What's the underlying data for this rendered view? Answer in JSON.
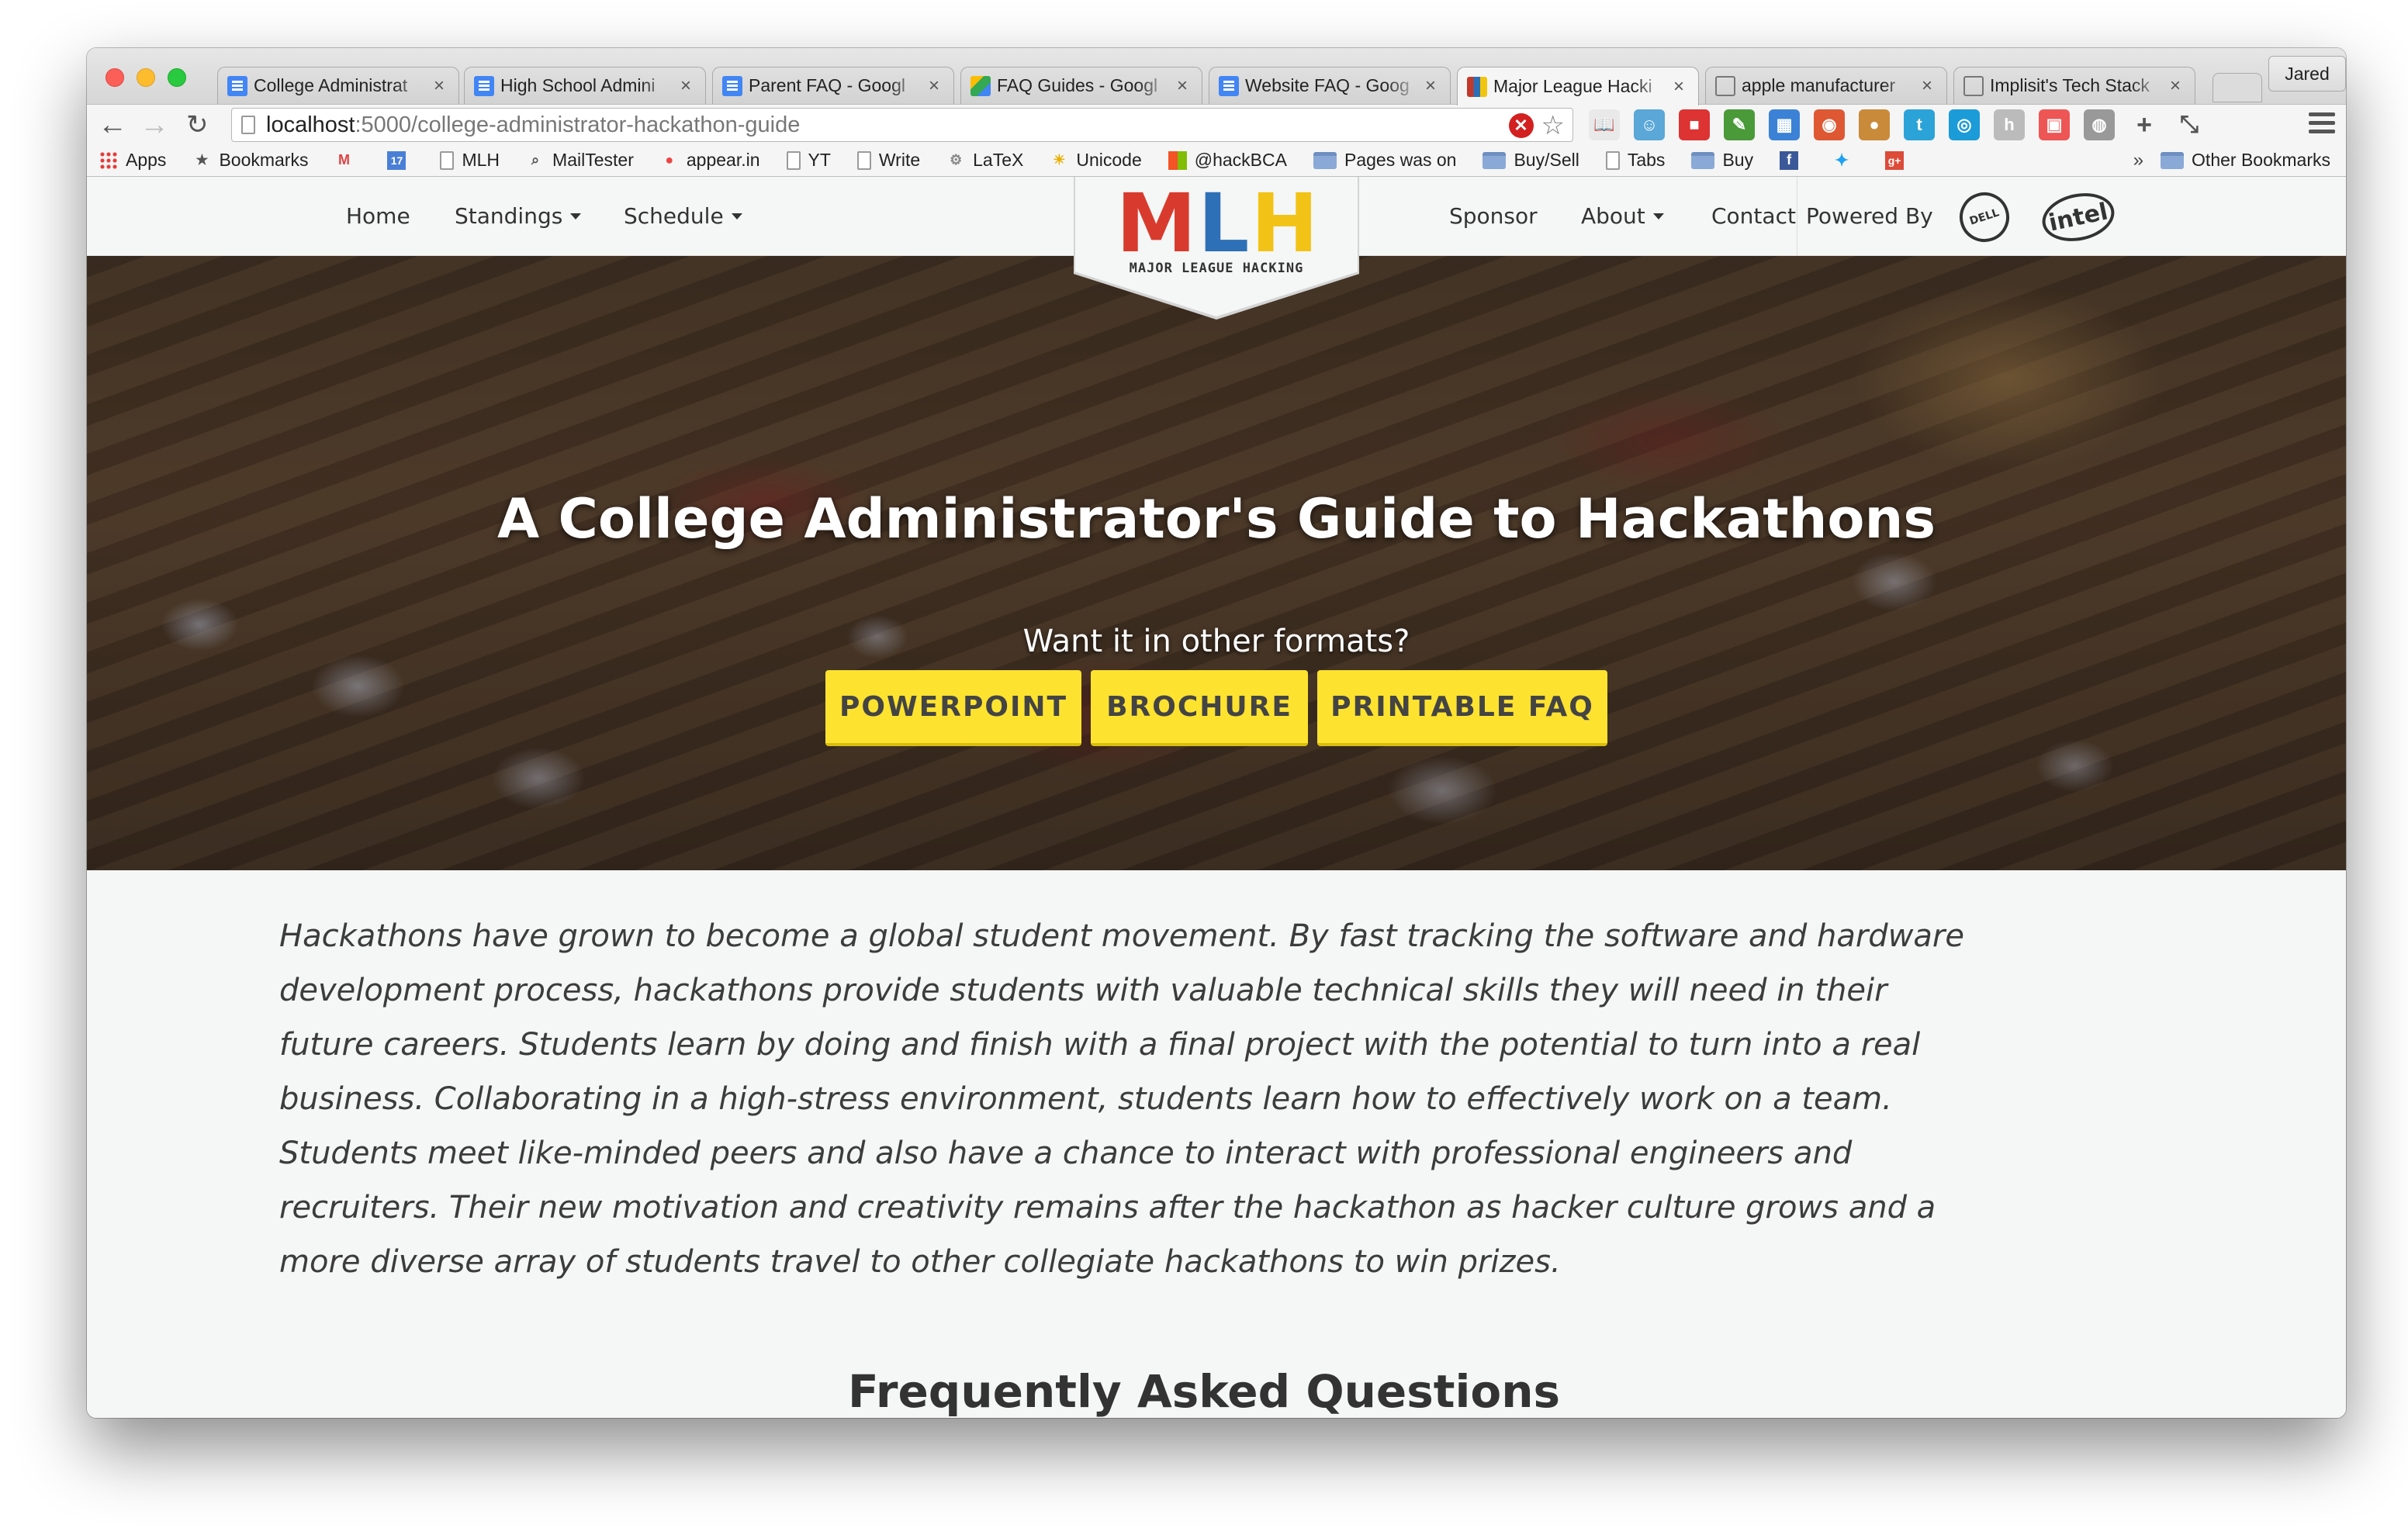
{
  "browser": {
    "tabs": [
      {
        "title": "College Administrat",
        "favicon": "docs-icon"
      },
      {
        "title": "High School Admini",
        "favicon": "docs-icon"
      },
      {
        "title": "Parent FAQ - Googl",
        "favicon": "docs-icon"
      },
      {
        "title": "FAQ Guides - Googl",
        "favicon": "drive-icon"
      },
      {
        "title": "Website FAQ - Goog",
        "favicon": "docs-icon"
      },
      {
        "title": "Major League Hacki",
        "favicon": "mlh-icon",
        "active": true
      },
      {
        "title": "apple manufacturer",
        "favicon": "mail-icon"
      },
      {
        "title": "Implisit's Tech Stack",
        "favicon": "mail-icon"
      }
    ],
    "profile_name": "Jared",
    "url_host": "localhost",
    "url_path": ":5000/college-administrator-hackathon-guide",
    "bookmarks": [
      {
        "label": "Apps",
        "icon": "apps-grid-icon"
      },
      {
        "label": "Bookmarks",
        "icon": "star-icon"
      },
      {
        "label": "",
        "icon": "gmail-icon"
      },
      {
        "label": "",
        "icon": "calendar-icon"
      },
      {
        "label": "MLH",
        "icon": "page-icon"
      },
      {
        "label": "MailTester",
        "icon": "search-page-icon"
      },
      {
        "label": "appear.in",
        "icon": "appearin-icon"
      },
      {
        "label": "YT",
        "icon": "page-icon"
      },
      {
        "label": "Write",
        "icon": "page-icon"
      },
      {
        "label": "LaTeX",
        "icon": "gear-icon"
      },
      {
        "label": "Unicode",
        "icon": "unicode-icon"
      },
      {
        "label": "@hackBCA",
        "icon": "windows-icon"
      },
      {
        "label": "Pages was on",
        "icon": "folder-icon"
      },
      {
        "label": "Buy/Sell",
        "icon": "folder-icon"
      },
      {
        "label": "Tabs",
        "icon": "page-icon"
      },
      {
        "label": "Buy",
        "icon": "folder-icon"
      }
    ],
    "bookmarks_more": "»",
    "other_bookmarks": "Other Bookmarks"
  },
  "site": {
    "nav_left": [
      {
        "label": "Home",
        "dropdown": false
      },
      {
        "label": "Standings",
        "dropdown": true
      },
      {
        "label": "Schedule",
        "dropdown": true
      }
    ],
    "nav_right": [
      {
        "label": "Sponsor",
        "dropdown": false
      },
      {
        "label": "About",
        "dropdown": true
      },
      {
        "label": "Contact",
        "dropdown": false
      }
    ],
    "powered_by": "Powered By",
    "sponsor_logos": [
      "DELL",
      "intel"
    ],
    "logo": {
      "letters": [
        "M",
        "L",
        "H"
      ],
      "tagline": "MAJOR LEAGUE HACKING"
    },
    "hero": {
      "title": "A College Administrator's Guide to Hackathons",
      "subtitle": "Want it in other formats?",
      "buttons": [
        "POWERPOINT",
        "BROCHURE",
        "PRINTABLE FAQ"
      ]
    },
    "intro_text": "Hackathons have grown to become a global student movement. By fast tracking the software and hardware development process, hackathons provide students with valuable technical skills they will need in their future careers. Students learn by doing and finish with a final project with the potential to turn into a real business. Collaborating in a high-stress environment, students learn how to effectively work on a team. Students meet like-minded peers and also have a chance to interact with professional engineers and recruiters. Their new motivation and creativity remains after the hackathon as hacker culture grows and a more diverse array of students travel to other collegiate hackathons to win prizes.",
    "faq_heading": "Frequently Asked Questions"
  },
  "colors": {
    "accent_yellow": "#fde330",
    "mlh_red": "#d83b2d",
    "mlh_blue": "#2e70b7",
    "mlh_yellow": "#f2c316"
  }
}
